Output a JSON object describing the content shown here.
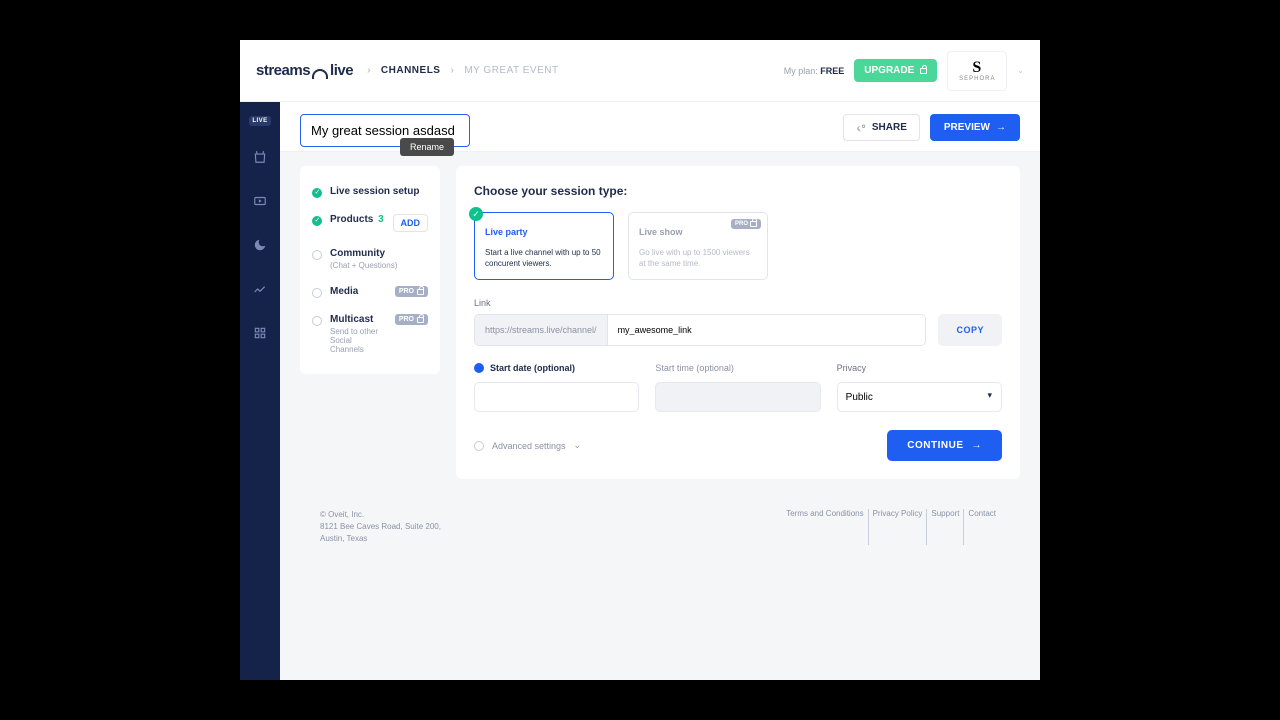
{
  "header": {
    "logo_text_1": "streams",
    "logo_text_2": "live",
    "breadcrumb_1": "CHANNELS",
    "breadcrumb_2": "MY GREAT EVENT",
    "plan_label": "My plan:",
    "plan_value": "FREE",
    "upgrade_label": "UPGRADE",
    "brand_name": "SEPHORA"
  },
  "rail": {
    "live_label": "LIVE"
  },
  "subheader": {
    "title_value": "My great session asdasd",
    "rename_tooltip": "Rename",
    "share_label": "SHARE",
    "preview_label": "PREVIEW"
  },
  "steps": {
    "s1": "Live session setup",
    "s2": "Products",
    "s2_count": "3",
    "s2_add": "ADD",
    "s3": "Community",
    "s3_sub": "(Chat + Questions)",
    "s4": "Media",
    "s5": "Multicast",
    "s5_sub": "Send to other Social Channels",
    "pro": "PRO"
  },
  "panel": {
    "heading": "Choose your session type:",
    "card1_title": "Live party",
    "card1_desc": "Start a live channel with up to 50 concurent viewers.",
    "card2_title": "Live show",
    "card2_desc": "Go live with up to 1500 viewers at the same time.",
    "pro": "PRO",
    "link_label": "Link",
    "link_prefix": "https://streams.live/channel/",
    "link_value": "my_awesome_link",
    "copy_label": "COPY",
    "start_date_label": "Start date (optional)",
    "start_time_label": "Start time (optional)",
    "privacy_label": "Privacy",
    "privacy_value": "Public",
    "advanced_label": "Advanced settings",
    "continue_label": "CONTINUE"
  },
  "footer": {
    "line1": "© Oveit, Inc.",
    "line2": "8121 Bee Caves Road, Suite 200,",
    "line3": "Austin, Texas",
    "l1": "Terms and Conditions",
    "l2": "Privacy Policy",
    "l3": "Support",
    "l4": "Contact"
  }
}
